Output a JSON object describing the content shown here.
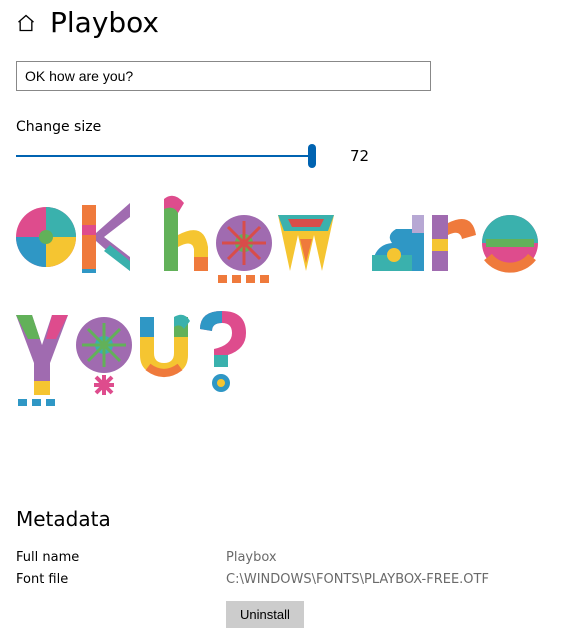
{
  "header": {
    "title": "Playbox"
  },
  "sample": {
    "value": "OK how are you?"
  },
  "size": {
    "label": "Change size",
    "value": "72",
    "min": "8",
    "max": "72"
  },
  "preview": {
    "text": "OK how are you?"
  },
  "metadata": {
    "heading": "Metadata",
    "full_name": {
      "label": "Full name",
      "value": "Playbox"
    },
    "font_file": {
      "label": "Font file",
      "value": "C:\\WINDOWS\\FONTS\\PLAYBOX-FREE.OTF"
    },
    "uninstall": "Uninstall"
  },
  "colors": {
    "pink": "#de4c8d",
    "teal": "#3ab1ad",
    "yellow": "#f5c531",
    "blue": "#2f97c5",
    "orange": "#ef7a3c",
    "purple": "#a06bb0",
    "green": "#62b159",
    "red": "#d84d4a",
    "lavender": "#b7a8d4"
  }
}
